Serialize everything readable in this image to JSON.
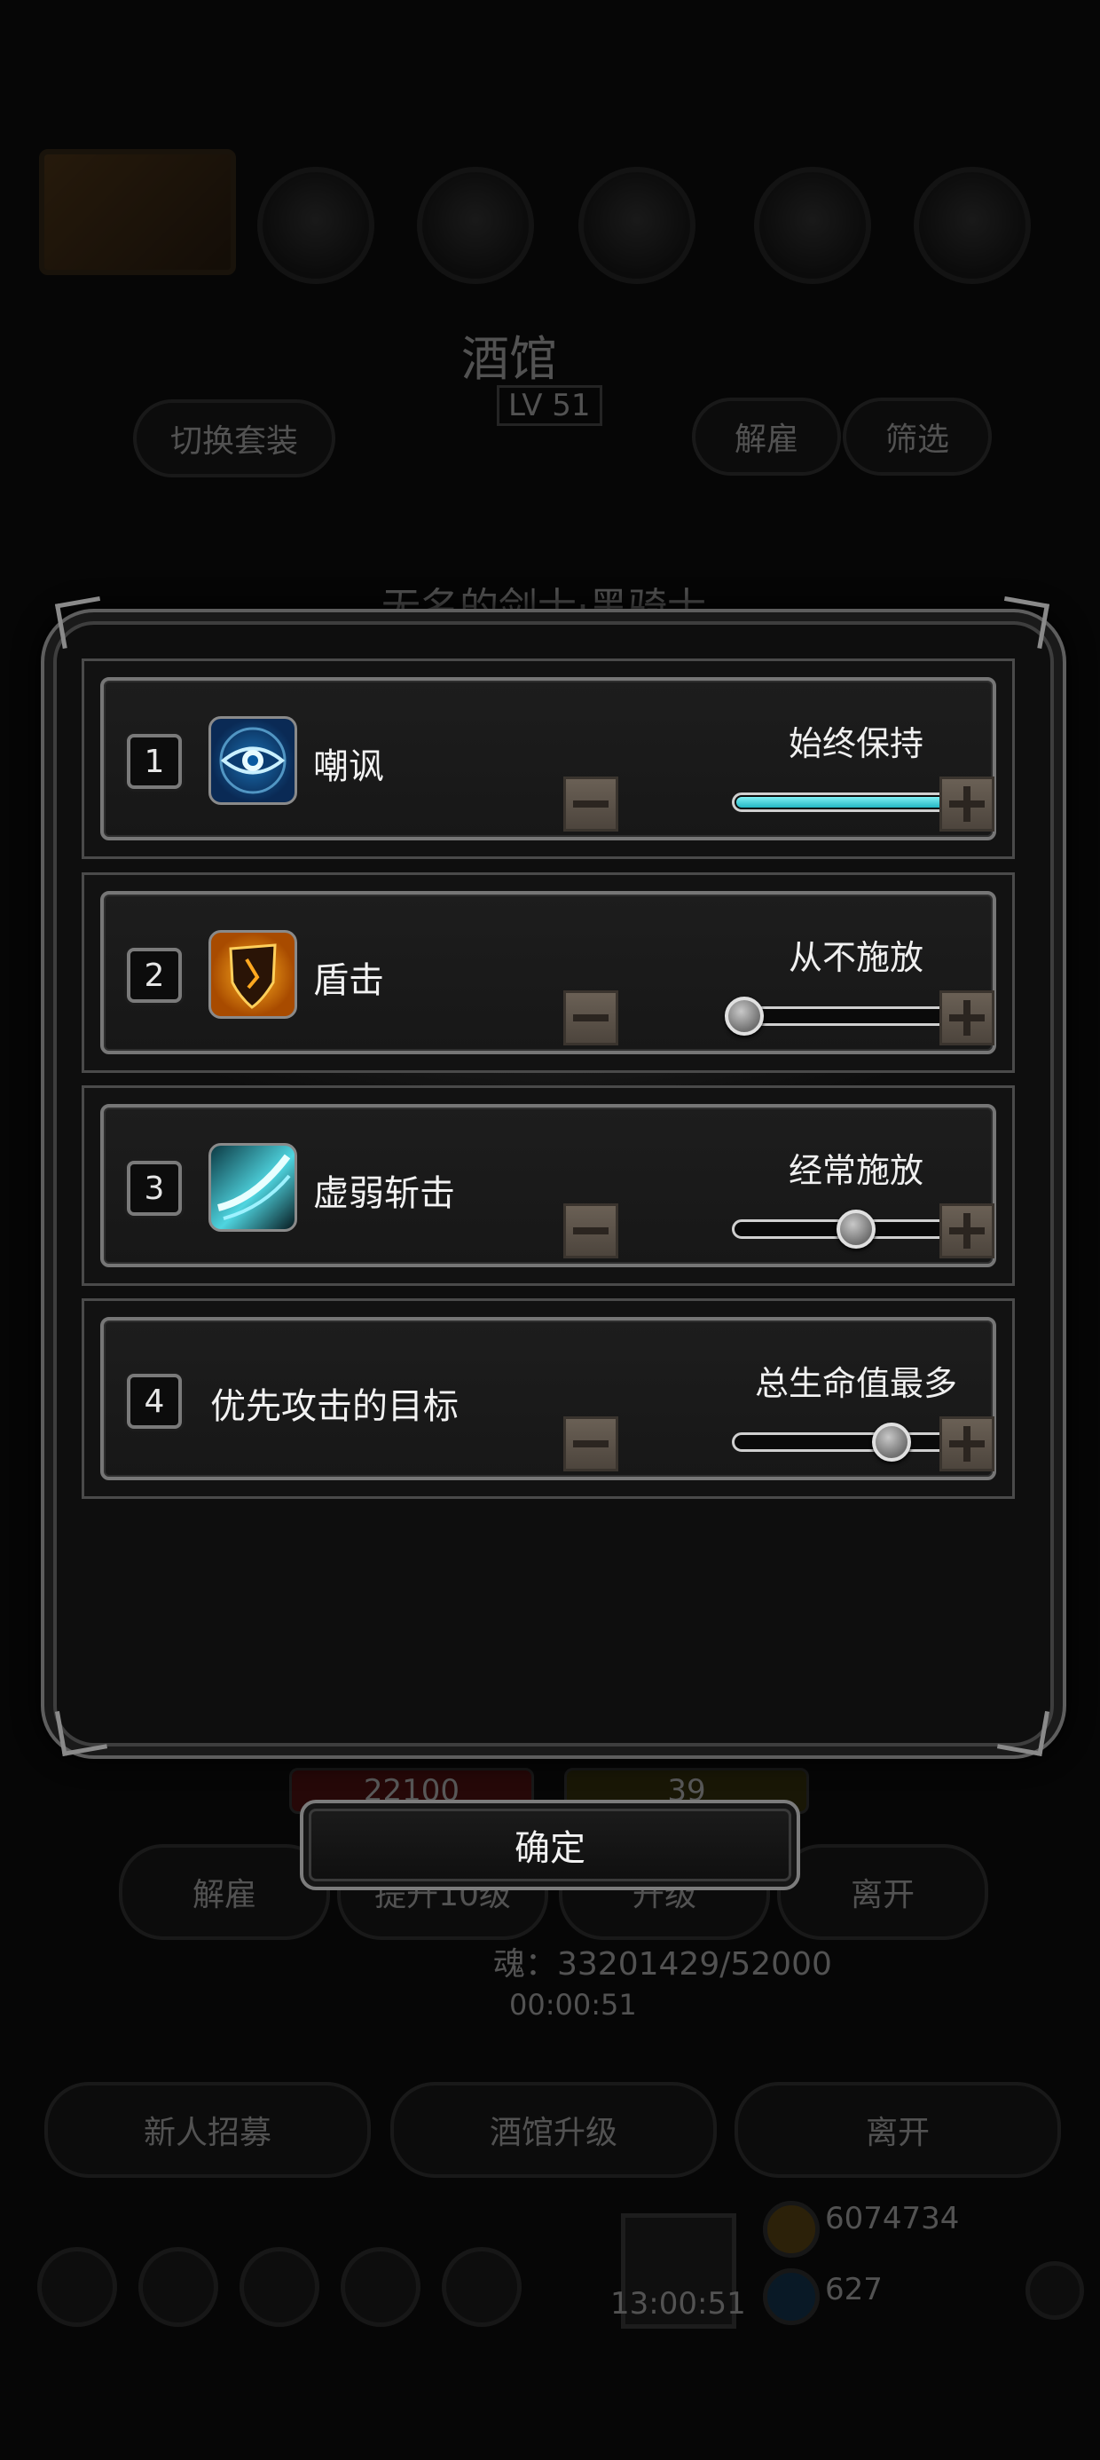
{
  "background": {
    "hero_title": "酒馆",
    "level": "LV 51",
    "switch_outfit": "切换套装",
    "fire_tab": "解雇",
    "filter_tab": "筛选",
    "hero_name": "无名的剑士·黑骑士",
    "hp_value": "22100",
    "energy_value": "39",
    "fire_button": "解雇",
    "upgrade10_button": "提升10级",
    "upgrade_button": "升级",
    "leave_button": "离开",
    "soul_text": "魂：33201429/52000",
    "timer_text": "00:00:51",
    "recruit_button": "新人招募",
    "tavern_upgrade_button": "酒馆升级",
    "leave_bottom_button": "离开",
    "clock_text": "13:00:51",
    "gold_text": "6074734",
    "gem_text": "627"
  },
  "skills": [
    {
      "index": "1",
      "name": "嘲讽",
      "icon": "eye-icon",
      "setting": "始终保持",
      "level": 1.0
    },
    {
      "index": "2",
      "name": "盾击",
      "icon": "shield-icon",
      "setting": "从不施放",
      "level": 0.0
    },
    {
      "index": "3",
      "name": "虚弱斩击",
      "icon": "slash-icon",
      "setting": "经常施放",
      "level": 0.5
    },
    {
      "index": "4",
      "name": "优先攻击的目标",
      "icon": "",
      "setting": "总生命值最多",
      "level": 0.66
    }
  ],
  "confirm_label": "确定",
  "colors": {
    "slider_fill": "#23b7c4",
    "dialog_border": "#5e5e5e",
    "step_button": "#5a5048"
  }
}
